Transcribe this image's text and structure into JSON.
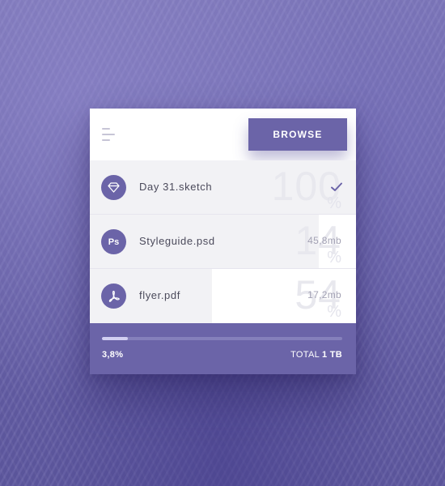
{
  "header": {
    "menu_icon": "menu-icon",
    "browse_label": "BROWSE"
  },
  "files": [
    {
      "name": "Day 31.sketch",
      "icon": "diamond-icon",
      "progress_percent": 100,
      "percent_text": "100",
      "percent_sign": "%",
      "status": "complete",
      "status_icon": "check-icon"
    },
    {
      "name": "Styleguide.psd",
      "icon_text": "Ps",
      "progress_percent": 14,
      "percent_text": "14",
      "percent_sign": "%",
      "size": "45,8mb"
    },
    {
      "name": "flyer.pdf",
      "icon": "pdf-icon",
      "progress_percent": 54,
      "percent_text": "54",
      "percent_sign": "%",
      "size": "17,2mb"
    }
  ],
  "footer": {
    "overall_progress_percent": 3.8,
    "percent_label": "3,8%",
    "total_prefix": "TOTAL",
    "total_value": "1 TB"
  },
  "colors": {
    "accent": "#6b64a8",
    "background": "#6a63a6",
    "row_pending": "#f2f2f5",
    "row_progress": "#ffffff"
  }
}
